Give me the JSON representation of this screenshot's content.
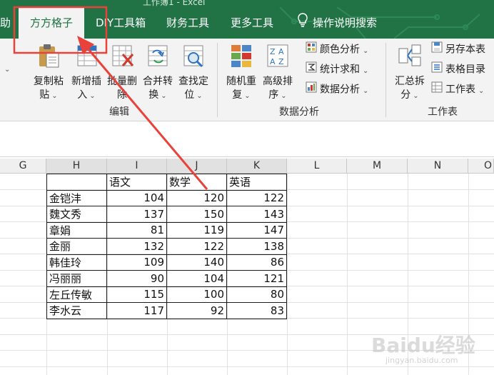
{
  "window": {
    "title_fragment": "工作簿1 - Excel"
  },
  "tabs": [
    {
      "label": "助"
    },
    {
      "label": "方方格子",
      "active": true
    },
    {
      "label": "DIY工具箱"
    },
    {
      "label": "财务工具"
    },
    {
      "label": "更多工具"
    },
    {
      "label": "操作说明搜索",
      "icon": "lightbulb-icon"
    }
  ],
  "ribbon": {
    "groups": [
      {
        "label": "编辑",
        "buttons": [
          {
            "line1": "复制粘",
            "line2": "贴",
            "icon": "paste-icon"
          },
          {
            "line1": "新增插",
            "line2": "入",
            "icon": "insert-icon"
          },
          {
            "line1": "批量删",
            "line2": "除",
            "icon": "batch-delete-icon"
          },
          {
            "line1": "合并转",
            "line2": "换",
            "icon": "merge-convert-icon"
          },
          {
            "line1": "查找定",
            "line2": "位",
            "icon": "find-locate-icon"
          }
        ]
      },
      {
        "label": "数据分析",
        "buttons": [
          {
            "line1": "随机重",
            "line2": "复",
            "icon": "random-repeat-icon"
          },
          {
            "line1": "高级排",
            "line2": "序",
            "icon": "advanced-sort-icon"
          }
        ],
        "small_buttons": [
          {
            "label": "颜色分析",
            "icon": "color-analysis-icon"
          },
          {
            "label": "统计求和",
            "icon": "stat-sum-icon"
          },
          {
            "label": "数据分析",
            "icon": "data-analysis-icon"
          }
        ]
      },
      {
        "label": "工作表",
        "buttons": [
          {
            "line1": "汇总拆",
            "line2": "分",
            "icon": "summary-split-icon"
          }
        ],
        "small_buttons": [
          {
            "label": "另存本表",
            "icon": "save-sheet-icon"
          },
          {
            "label": "表格目录",
            "icon": "sheet-directory-icon"
          },
          {
            "label": "工作表",
            "icon": "worksheet-icon"
          }
        ]
      }
    ]
  },
  "columns": [
    "G",
    "H",
    "I",
    "J",
    "K",
    "L",
    "M",
    "N",
    "O"
  ],
  "selected_columns": [
    "H",
    "I",
    "J",
    "K"
  ],
  "table": {
    "headers": [
      "",
      "语文",
      "数学",
      "英语"
    ],
    "rows": [
      [
        "金铠沣",
        "104",
        "120",
        "122"
      ],
      [
        "魏文秀",
        "137",
        "150",
        "143"
      ],
      [
        "章娟",
        "81",
        "119",
        "147"
      ],
      [
        "金丽",
        "132",
        "122",
        "138"
      ],
      [
        "韩佳玲",
        "109",
        "140",
        "86"
      ],
      [
        "冯丽丽",
        "90",
        "104",
        "121"
      ],
      [
        "左丘传敏",
        "115",
        "100",
        "80"
      ],
      [
        "李水云",
        "117",
        "92",
        "83"
      ]
    ]
  },
  "watermark": {
    "main": "Baidu经验",
    "sub": "jingyan.baidu.com"
  },
  "colors": {
    "ribbon_green": "#217346",
    "annotation_red": "#e8423b"
  }
}
